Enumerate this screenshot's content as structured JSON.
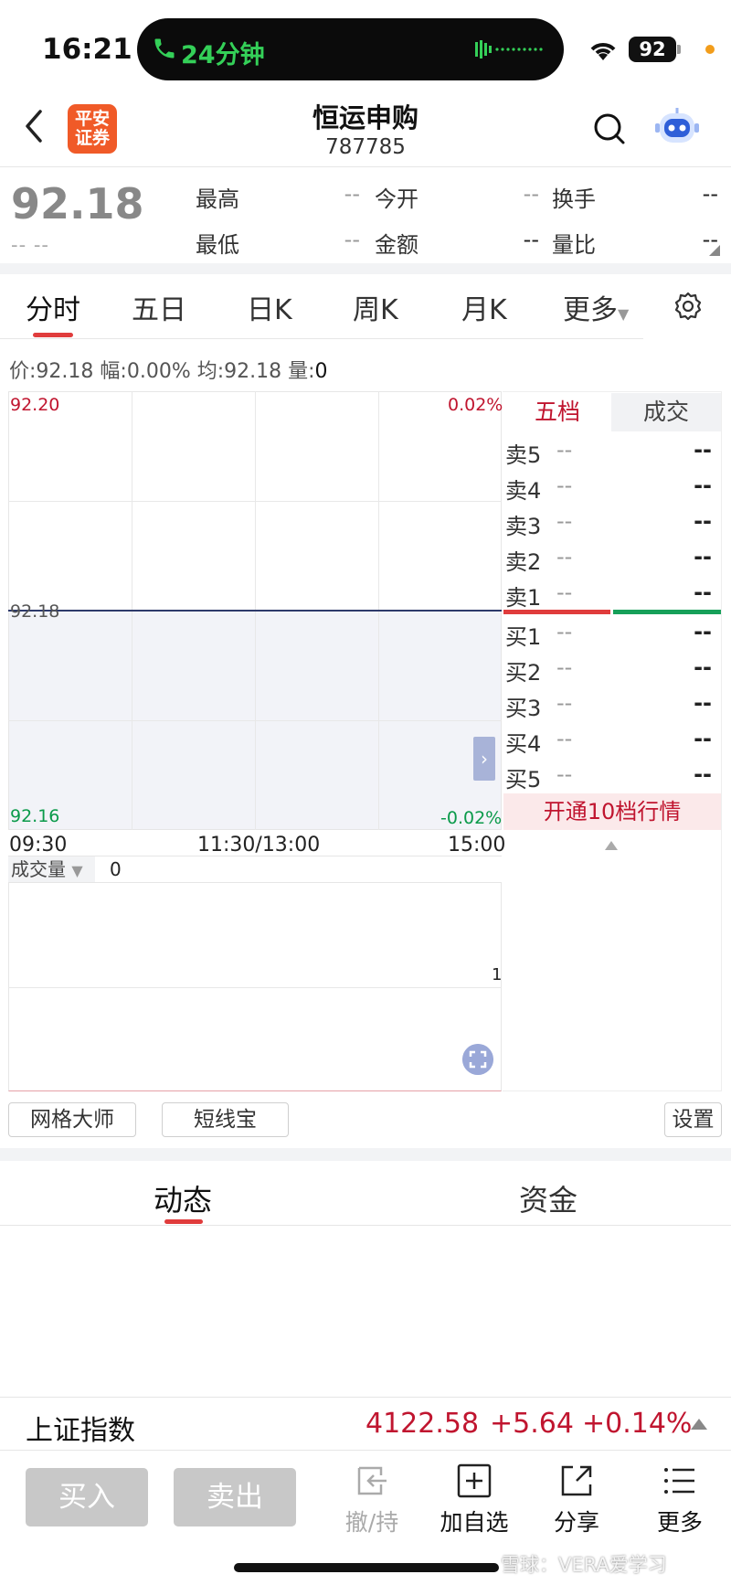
{
  "status_bar": {
    "time": "16:21",
    "call_text": "24分钟",
    "battery": "92"
  },
  "header": {
    "logo_text": "平安\n证券",
    "title": "恒运申购",
    "code": "787785"
  },
  "quote": {
    "price": "92.18",
    "price_sub": "-- --",
    "fields": [
      {
        "label": "最高",
        "value": "--"
      },
      {
        "label": "今开",
        "value": "--"
      },
      {
        "label": "换手",
        "value": "--"
      },
      {
        "label": "最低",
        "value": "--"
      },
      {
        "label": "金额",
        "value": "--"
      },
      {
        "label": "量比",
        "value": "--"
      }
    ]
  },
  "chart_tabs": [
    "分时",
    "五日",
    "日K",
    "周K",
    "月K",
    "更多"
  ],
  "info_line": {
    "price_label": "价:",
    "price": "92.18",
    "amp_label": "幅:",
    "amp": "0.00%",
    "avg_label": "均:",
    "avg": "92.18",
    "vol_label": "量:",
    "vol": "0"
  },
  "chart_data": {
    "type": "line",
    "x_axis_labels": [
      "09:30",
      "11:30/13:00",
      "15:00"
    ],
    "y_left_ticks": [
      "92.20",
      "92.18",
      "92.16"
    ],
    "y_right_ticks": [
      "0.02%",
      "-0.02%"
    ],
    "ylim": [
      92.16,
      92.2
    ],
    "series": [
      {
        "values": [
          92.18,
          92.18
        ]
      }
    ],
    "volume": {
      "label": "成交量",
      "value": "0",
      "axis_max": "1"
    }
  },
  "order_book": {
    "tabs": [
      "五档",
      "成交"
    ],
    "asks": [
      {
        "side": "卖5",
        "price": "--",
        "vol": "--"
      },
      {
        "side": "卖4",
        "price": "--",
        "vol": "--"
      },
      {
        "side": "卖3",
        "price": "--",
        "vol": "--"
      },
      {
        "side": "卖2",
        "price": "--",
        "vol": "--"
      },
      {
        "side": "卖1",
        "price": "--",
        "vol": "--"
      }
    ],
    "bids": [
      {
        "side": "买1",
        "price": "--",
        "vol": "--"
      },
      {
        "side": "买2",
        "price": "--",
        "vol": "--"
      },
      {
        "side": "买3",
        "price": "--",
        "vol": "--"
      },
      {
        "side": "买4",
        "price": "--",
        "vol": "--"
      },
      {
        "side": "买5",
        "price": "--",
        "vol": "--"
      }
    ],
    "upgrade": "开通10档行情"
  },
  "chips": {
    "grid_master": "网格大师",
    "short_line": "短线宝",
    "settings": "设置"
  },
  "news_tabs": [
    "动态",
    "资金"
  ],
  "index_bar": {
    "name": "上证指数",
    "value": "4122.58",
    "change": "+5.64",
    "pct": "+0.14%"
  },
  "bottom": {
    "buy": "买入",
    "sell": "卖出",
    "cancel": "撤/持",
    "add_fav": "加自选",
    "share": "分享",
    "more": "更多"
  },
  "watermark": "雪球：VERA爱学习",
  "colors": {
    "up": "#c0152f",
    "down": "#0a9a4a",
    "accent": "#e03c3c"
  }
}
